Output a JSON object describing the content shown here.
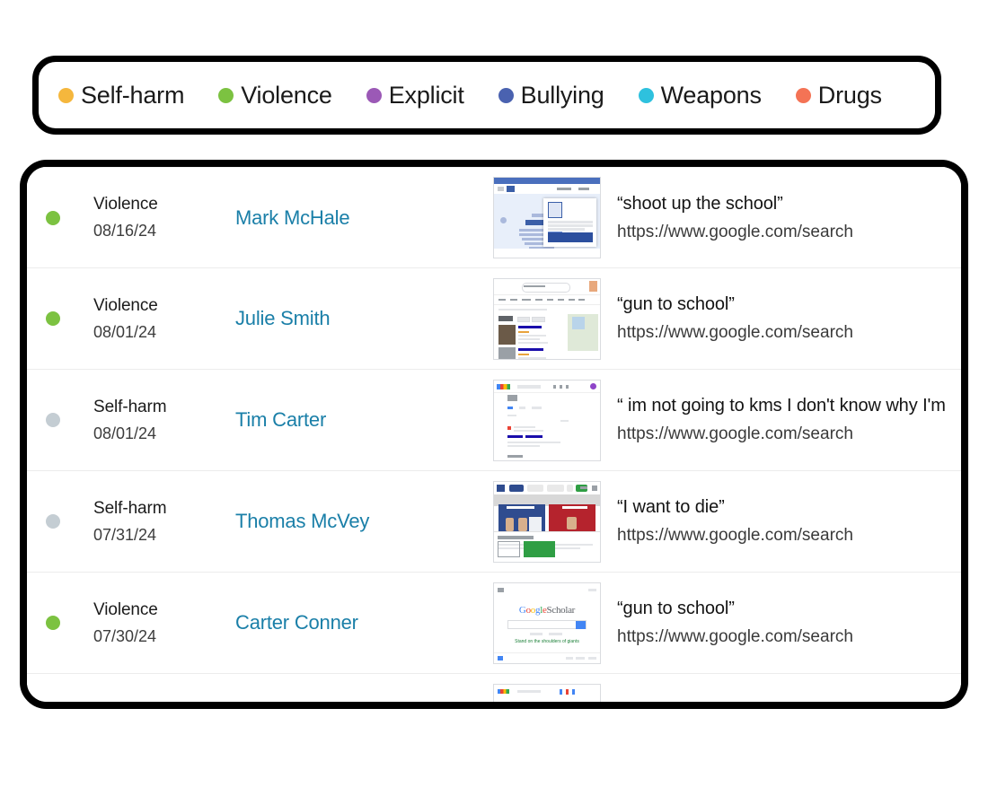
{
  "legend": {
    "items": [
      {
        "label": "Self-harm",
        "color": "#f5b73d",
        "icon": "legend-dot-icon"
      },
      {
        "label": "Violence",
        "color": "#7cc241",
        "icon": "legend-dot-icon"
      },
      {
        "label": "Explicit",
        "color": "#9b59b6",
        "icon": "legend-dot-icon"
      },
      {
        "label": "Bullying",
        "color": "#4a62b0",
        "icon": "legend-dot-icon"
      },
      {
        "label": "Weapons",
        "color": "#2ec1de",
        "icon": "legend-dot-icon"
      },
      {
        "label": "Drugs",
        "color": "#f47355",
        "icon": "legend-dot-icon"
      }
    ]
  },
  "table": {
    "rows": [
      {
        "status_color": "#7cc241",
        "category": "Violence",
        "date": "08/16/24",
        "student": "Mark McHale",
        "query": "“shoot up the school”",
        "url": "https://www.google.com/search",
        "thumbnail": "screenshot-thumbnail-blue-modal-page"
      },
      {
        "status_color": "#7cc241",
        "category": "Violence",
        "date": "08/01/24",
        "student": "Julie Smith",
        "query": "“gun to school”",
        "url": "https://www.google.com/search",
        "thumbnail": "screenshot-thumbnail-google-places-results"
      },
      {
        "status_color": "#c4cdd3",
        "category": "Self-harm",
        "date": "08/01/24",
        "student": "Tim Carter",
        "query": "“ im not going to kms I don't know why I'm",
        "url": "https://www.google.com/search",
        "thumbnail": "screenshot-thumbnail-google-search-results"
      },
      {
        "status_color": "#c4cdd3",
        "category": "Self-harm",
        "date": "07/31/24",
        "student": "Thomas McVey",
        "query": "“I want to die”",
        "url": "https://www.google.com/search",
        "thumbnail": "screenshot-thumbnail-news-cookie-banner"
      },
      {
        "status_color": "#7cc241",
        "category": "Violence",
        "date": "07/30/24",
        "student": "Carter Conner",
        "query": "“gun to school”",
        "url": "https://www.google.com/search",
        "thumbnail": "screenshot-thumbnail-google-scholar"
      },
      {
        "status_color": "#ffffff",
        "category": "",
        "date": "",
        "student": "",
        "query": "",
        "url": "",
        "thumbnail": "screenshot-thumbnail-partial"
      }
    ]
  },
  "thumbnails": {
    "scholar_wordmark": {
      "g1": "G",
      "o1": "o",
      "o2": "o",
      "g2": "g",
      "l": "l",
      "e": "e",
      "scholar": "Scholar"
    },
    "scholar_tagline": "Stand on the shoulders of giants"
  }
}
